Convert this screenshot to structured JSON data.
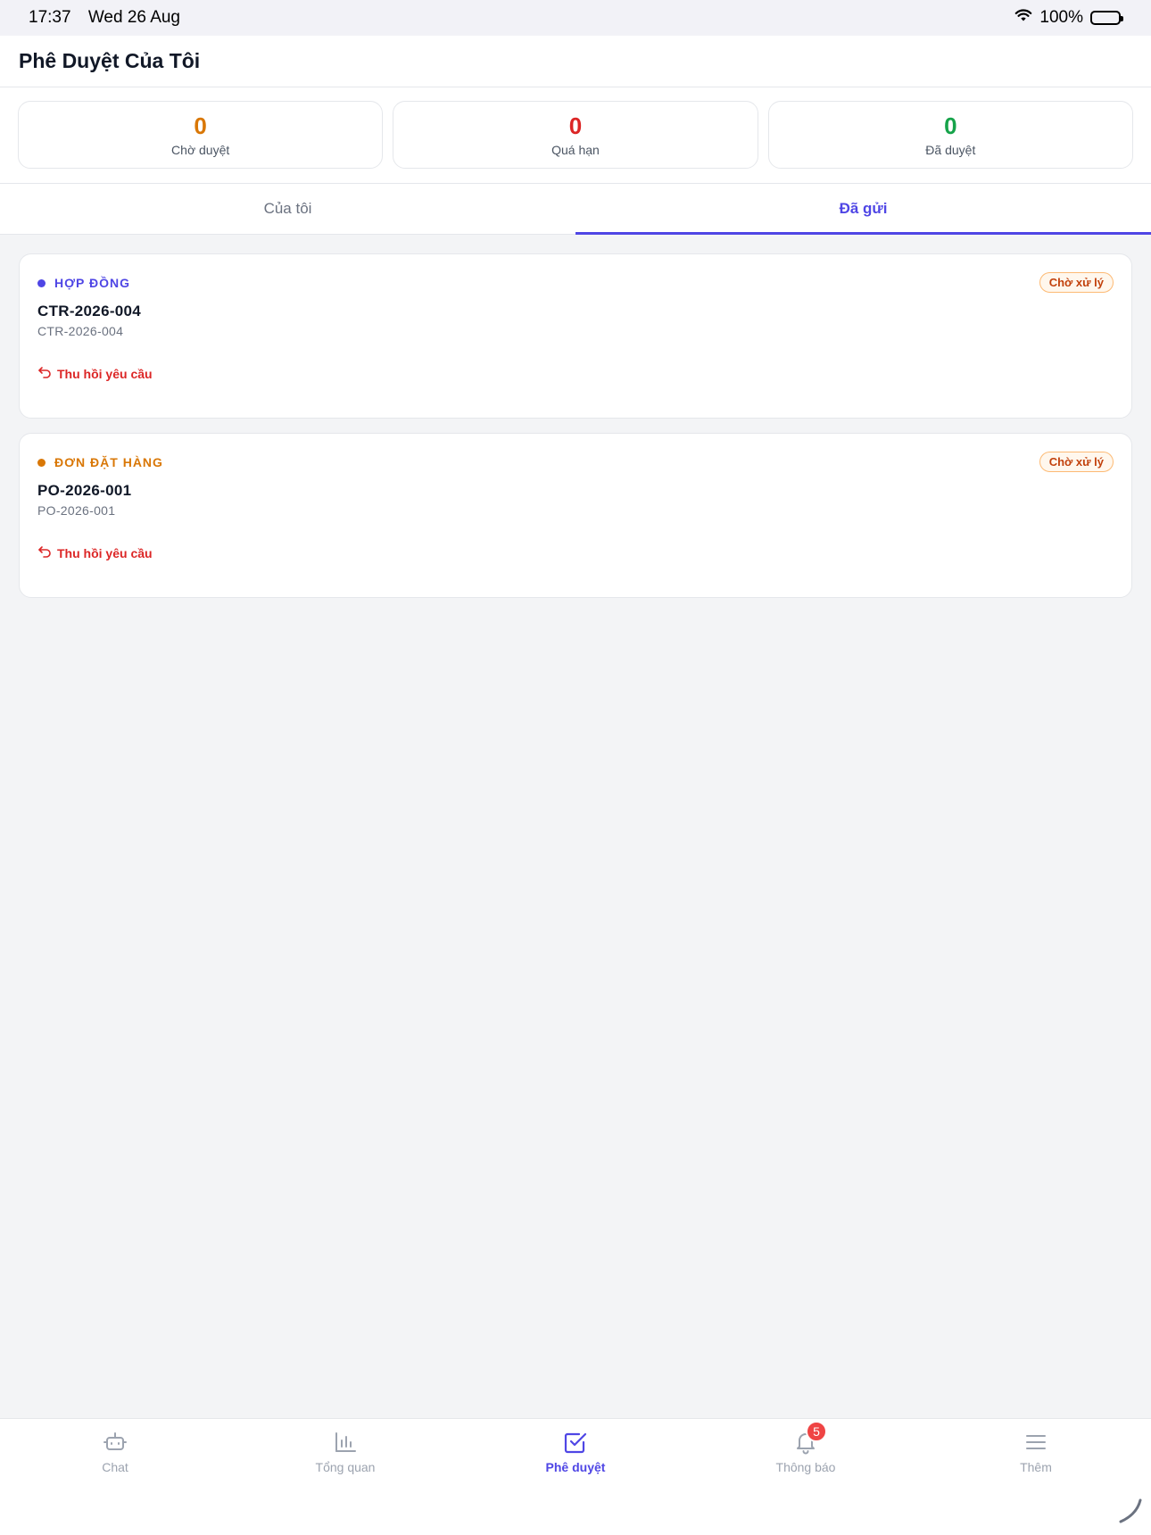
{
  "status_bar": {
    "time": "17:37",
    "date": "Wed 26 Aug",
    "battery": "100%"
  },
  "header": {
    "title": "Phê Duyệt Của Tôi"
  },
  "stats": [
    {
      "value": "0",
      "label": "Chờ duyệt",
      "color": "#d97706"
    },
    {
      "value": "0",
      "label": "Quá hạn",
      "color": "#dc2626"
    },
    {
      "value": "0",
      "label": "Đã duyệt",
      "color": "#16a34a"
    }
  ],
  "tabs": [
    {
      "label": "Của tôi",
      "active": false
    },
    {
      "label": "Đã gửi",
      "active": true
    }
  ],
  "cards": [
    {
      "type": "HỢP ĐỒNG",
      "type_color": "#4f46e5",
      "code": "CTR-2026-004",
      "sub": "CTR-2026-004",
      "status": "Chờ xử lý",
      "action": "Thu hồi yêu cầu"
    },
    {
      "type": "ĐƠN ĐẶT HÀNG",
      "type_color": "#d97706",
      "code": "PO-2026-001",
      "sub": "PO-2026-001",
      "status": "Chờ xử lý",
      "action": "Thu hồi yêu cầu"
    }
  ],
  "bottom_nav": [
    {
      "label": "Chat",
      "icon": "robot-icon",
      "active": false
    },
    {
      "label": "Tổng quan",
      "icon": "bar-chart-icon",
      "active": false
    },
    {
      "label": "Phê duyệt",
      "icon": "checkbox-icon",
      "active": true
    },
    {
      "label": "Thông báo",
      "icon": "bell-icon",
      "active": false,
      "badge": "5"
    },
    {
      "label": "Thêm",
      "icon": "menu-icon",
      "active": false
    }
  ],
  "colors": {
    "accent": "#4f46e5",
    "danger": "#dc2626",
    "muted": "#9ca3af"
  }
}
